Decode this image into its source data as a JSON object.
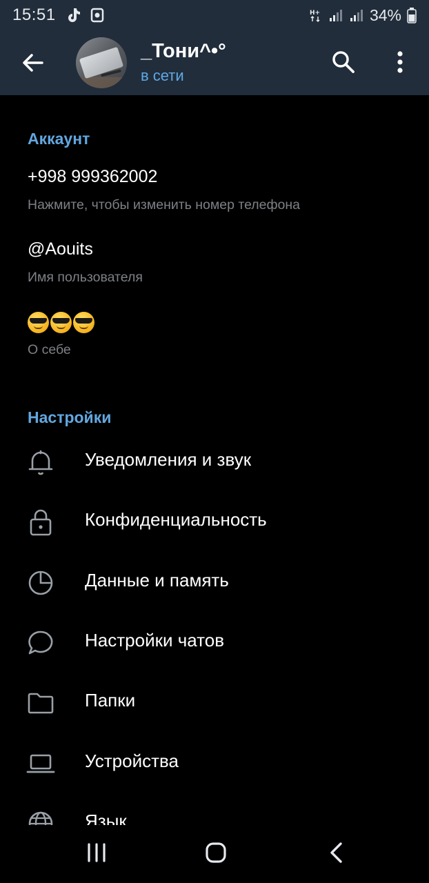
{
  "status_bar": {
    "time": "15:51",
    "battery": "34%",
    "network_label": "H+"
  },
  "header": {
    "name": "_Тони^•°",
    "status": "в сети"
  },
  "account": {
    "section_title": "Аккаунт",
    "phone": "+998 999362002",
    "phone_hint": "Нажмите, чтобы изменить номер телефона",
    "username": "@Aouits",
    "username_hint": "Имя пользователя",
    "bio_hint": "О себе"
  },
  "settings": {
    "section_title": "Настройки",
    "items": [
      {
        "label": "Уведомления и звук",
        "icon": "bell-icon"
      },
      {
        "label": "Конфиденциальность",
        "icon": "lock-icon"
      },
      {
        "label": "Данные и память",
        "icon": "pie-chart-icon"
      },
      {
        "label": "Настройки чатов",
        "icon": "chat-bubble-icon"
      },
      {
        "label": "Папки",
        "icon": "folder-icon"
      },
      {
        "label": "Устройства",
        "icon": "laptop-icon"
      },
      {
        "label": "Язык",
        "icon": "globe-icon"
      }
    ]
  },
  "colors": {
    "header_bg": "#212d3b",
    "accent": "#62a7e0",
    "online": "#5fa8e6",
    "background": "#000000",
    "hint": "#7d8085"
  }
}
